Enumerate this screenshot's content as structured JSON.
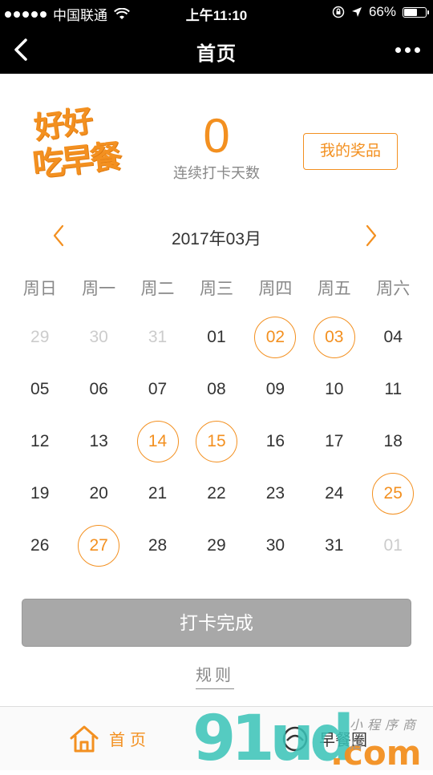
{
  "status_bar": {
    "carrier": "中国联通",
    "time": "上午11:10",
    "battery": "66%",
    "battery_level": 0.66
  },
  "nav": {
    "title": "首页"
  },
  "header": {
    "logo_line1": "好好",
    "logo_line2": "吃早餐",
    "streak_count": "0",
    "streak_label": "连续打卡天数",
    "prize_button": "我的奖品"
  },
  "calendar": {
    "month_label": "2017年03月",
    "weekdays": [
      "周日",
      "周一",
      "周二",
      "周三",
      "周四",
      "周五",
      "周六"
    ],
    "weeks": [
      [
        {
          "d": "29",
          "other": true
        },
        {
          "d": "30",
          "other": true
        },
        {
          "d": "31",
          "other": true
        },
        {
          "d": "01"
        },
        {
          "d": "02",
          "checked": true
        },
        {
          "d": "03",
          "checked": true
        },
        {
          "d": "04"
        }
      ],
      [
        {
          "d": "05"
        },
        {
          "d": "06"
        },
        {
          "d": "07"
        },
        {
          "d": "08"
        },
        {
          "d": "09"
        },
        {
          "d": "10"
        },
        {
          "d": "11"
        }
      ],
      [
        {
          "d": "12"
        },
        {
          "d": "13"
        },
        {
          "d": "14",
          "checked": true
        },
        {
          "d": "15",
          "checked": true
        },
        {
          "d": "16"
        },
        {
          "d": "17"
        },
        {
          "d": "18"
        }
      ],
      [
        {
          "d": "19"
        },
        {
          "d": "20"
        },
        {
          "d": "21"
        },
        {
          "d": "22"
        },
        {
          "d": "23"
        },
        {
          "d": "24"
        },
        {
          "d": "25",
          "checked": true
        }
      ],
      [
        {
          "d": "26"
        },
        {
          "d": "27",
          "checked": true
        },
        {
          "d": "28"
        },
        {
          "d": "29"
        },
        {
          "d": "30"
        },
        {
          "d": "31"
        },
        {
          "d": "01",
          "other": true
        }
      ]
    ]
  },
  "actions": {
    "checkin_button": "打卡完成",
    "rules_link": "规则"
  },
  "tabbar": {
    "home_label": "首页",
    "circle_label": "早餐圈"
  },
  "watermark": {
    "big": "91ud",
    "com": ".com",
    "sub": "小程序商店"
  },
  "colors": {
    "accent": "#f39020",
    "nav_bg": "#000000",
    "button_disabled": "#a8a8a8"
  }
}
